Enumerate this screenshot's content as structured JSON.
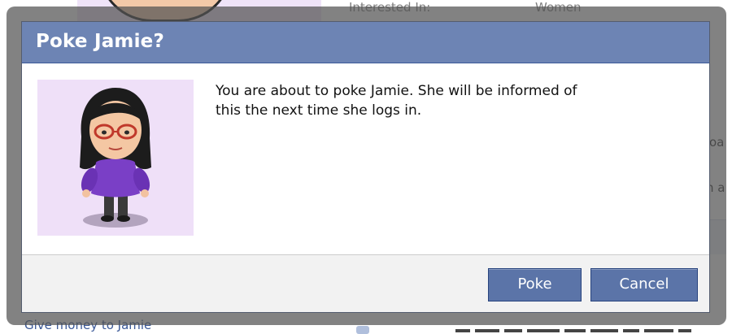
{
  "background": {
    "interested_label": "Interested In:",
    "interested_value": "Women",
    "edge_text_1": "oa",
    "edge_text_2": "n a",
    "give_money_link": "Give money to Jamie"
  },
  "dialog": {
    "title": "Poke Jamie?",
    "avatar_icon": "mii-avatar-jamie",
    "message": "You are about to poke Jamie. She will be informed of this the next time she logs in.",
    "buttons": {
      "poke": "Poke",
      "cancel": "Cancel"
    }
  },
  "colors": {
    "header": "#6d84b4",
    "button": "#5b74a8",
    "overlay": "#525252",
    "avatar_bg": "#efe0f8"
  }
}
